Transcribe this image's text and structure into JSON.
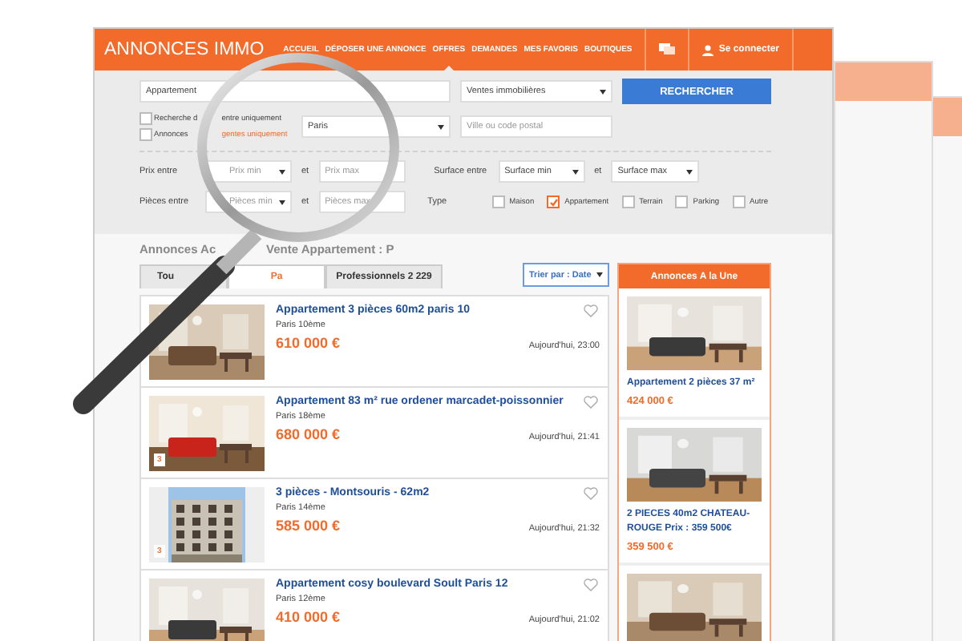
{
  "header": {
    "logo": "ANNONCES IMMO",
    "login": "Se connecter",
    "nav": [
      {
        "label": "ACCUEIL",
        "selected": false
      },
      {
        "label": "DÉPOSER UNE ANNONCE",
        "selected": false
      },
      {
        "label": "OFFRES",
        "selected": true
      },
      {
        "label": "DEMANDES",
        "selected": false
      },
      {
        "label": "MES FAVORIS",
        "selected": false
      },
      {
        "label": "BOUTIQUES",
        "selected": false
      }
    ]
  },
  "search": {
    "query": "Appartement",
    "category": "Ventes immobilières",
    "button": "RECHERCHER",
    "region": "Paris",
    "city_placeholder": "Ville ou code postal",
    "options": [
      {
        "label": "Recherche d",
        "suffix": "entre uniquement",
        "checked": false
      },
      {
        "label": "Annonces",
        "suffix": "gentes uniquement",
        "checked": false
      }
    ],
    "filters": [
      {
        "label": "Prix entre",
        "min": "Prix min",
        "and": "et",
        "max": "Prix max"
      },
      {
        "label": "Pièces entre",
        "min": "Pièces min",
        "and": "et",
        "max": "Pièces max"
      }
    ],
    "surface": {
      "label": "Surface entre",
      "min": "Surface min",
      "and": "et",
      "max": "Surface max"
    },
    "type": {
      "label": "Type",
      "options": [
        {
          "label": "Maison",
          "checked": false
        },
        {
          "label": "Appartement",
          "checked": true
        },
        {
          "label": "Terrain",
          "checked": false
        },
        {
          "label": "Parking",
          "checked": false
        },
        {
          "label": "Autre",
          "checked": false
        }
      ]
    }
  },
  "results": {
    "title_start": "Annonces Ac",
    "title_end": "Vente Appartement : P",
    "sort": "Trier par : Date",
    "tabs": [
      {
        "label": "Tou",
        "selected": false
      },
      {
        "label": "Pa",
        "selected": true
      },
      {
        "label": "Professionnels 2 229",
        "selected": false
      }
    ],
    "listings": [
      {
        "title": "Appartement 3 pièces 60m2 paris 10",
        "location": "Paris 10ème",
        "price": "610 000 €",
        "date": "Aujourd'hui, 23:00"
      },
      {
        "title": "Appartement 83 m² rue ordener marcadet-poissonnier",
        "location": "Paris 18ème",
        "price": "680 000 €",
        "date": "Aujourd'hui, 21:41",
        "photos": "3"
      },
      {
        "title": "3 pièces - Montsouris - 62m2",
        "location": "Paris 14ème",
        "price": "585 000 €",
        "date": "Aujourd'hui, 21:32",
        "photos": "3"
      },
      {
        "title": "Appartement cosy boulevard Soult Paris 12",
        "location": "Paris 12ème",
        "price": "410 000 €",
        "date": "Aujourd'hui, 21:02"
      }
    ]
  },
  "featured": {
    "title": "Annonces A la Une",
    "items": [
      {
        "title": "Appartement 2 pièces 37 m²",
        "price": "424 000 €"
      },
      {
        "title": "2 PIECES 40m2 CHATEAU-ROUGE Prix : 359 500€",
        "price": "359 500 €"
      },
      {
        "kind": "picture"
      }
    ]
  }
}
